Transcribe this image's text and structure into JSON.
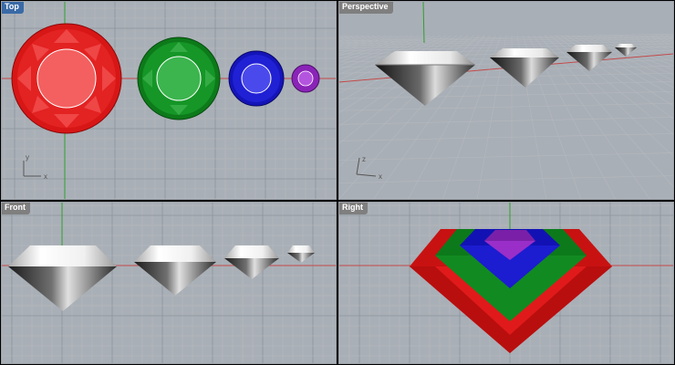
{
  "viewports": {
    "top": {
      "label": "Top",
      "axis_x": "x",
      "axis_y": "y"
    },
    "perspective": {
      "label": "Perspective",
      "axis_x": "x",
      "axis_y": "z"
    },
    "front": {
      "label": "Front"
    },
    "right": {
      "label": "Right"
    }
  },
  "gem_colors": {
    "red": "#e01818",
    "green": "#0f8a1e",
    "blue": "#1a1ad0",
    "purple": "#9a2ec8"
  },
  "colors": {
    "viewport_bg": "#a8aeb5",
    "grid_minor": "#b4b9bf",
    "grid_major": "#8e949b",
    "x_axis": "#c24a4a",
    "y_axis": "#2ea02e",
    "active_label_bg": "#3a6aa6",
    "inactive_label_bg": "#7f7f7f"
  }
}
